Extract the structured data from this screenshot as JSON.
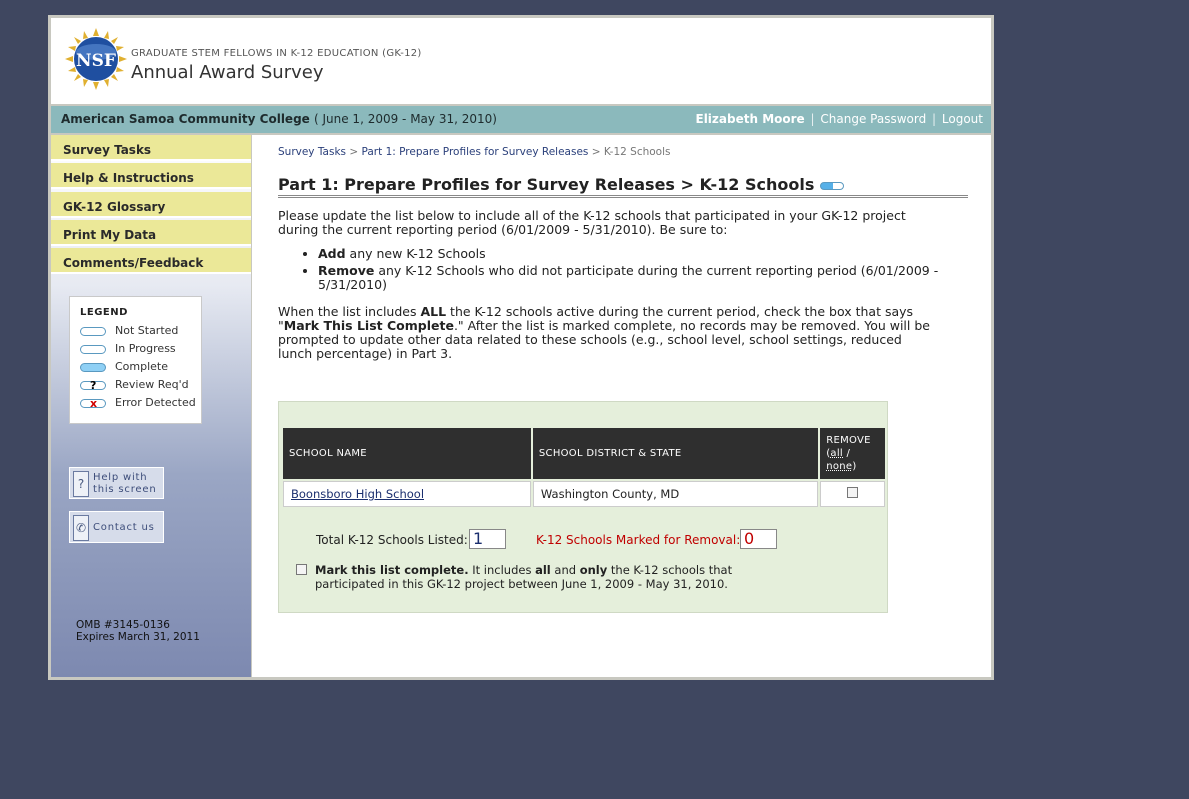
{
  "header": {
    "program": "GRADUATE STEM FELLOWS IN K-12 EDUCATION (GK-12)",
    "title": "Annual Award Survey",
    "logo_text": "NSF"
  },
  "infobar": {
    "institution": "American Samoa Community College",
    "period": "( June 1, 2009 - May 31, 2010)",
    "user": "Elizabeth Moore",
    "change_password": "Change Password",
    "logout": "Logout",
    "separator": "|"
  },
  "sidebar": {
    "nav": [
      "Survey Tasks",
      "Help & Instructions",
      "GK-12 Glossary",
      "Print My Data",
      "Comments/Feedback"
    ],
    "legend": {
      "title": "LEGEND",
      "items": [
        "Not Started",
        "In Progress",
        "Complete",
        "Review Req'd",
        "Error Detected"
      ],
      "review_mark": "?",
      "error_mark": "x"
    },
    "help_line1": "Help with",
    "help_line2": "this screen",
    "help_icon": "?",
    "contact": "Contact us",
    "omb_line1": "OMB #3145-0136",
    "omb_line2": "Expires March 31, 2011"
  },
  "breadcrumb": {
    "c1": "Survey Tasks",
    "c2": "Part 1: Prepare Profiles for Survey Releases",
    "c3": "K-12 Schools",
    "sep": ">"
  },
  "page": {
    "title": "Part 1: Prepare Profiles for Survey Releases > K-12 Schools",
    "intro": "Please update the list below to include all of the K-12 schools that participated in your GK-12 project during the current reporting period (6/01/2009 - 5/31/2010). Be sure to:",
    "bullet1_bold": "Add",
    "bullet1_rest": " any new K-12 Schools",
    "bullet2_bold": "Remove",
    "bullet2_rest": " any K-12 Schools who did not participate during the current reporting period (6/01/2009 - 5/31/2010)",
    "instr_a": "When the list includes ",
    "instr_b": "ALL",
    "instr_c": " the K-12 schools active during the current period, check the box that says \"",
    "instr_d": "Mark This List Complete",
    "instr_e": ".\" After the list is marked complete, no records may be removed. You will be prompted to update other data related to these schools (e.g., school level, school settings, reduced lunch percentage) in Part 3."
  },
  "table": {
    "col_school": "SCHOOL NAME",
    "col_district": "SCHOOL DISTRICT & STATE",
    "col_remove": "REMOVE",
    "remove_all": "all",
    "remove_slash": " / ",
    "remove_none": "none",
    "rows": [
      {
        "school": "Boonsboro High School",
        "district": "Washington County, MD",
        "remove": false
      }
    ]
  },
  "totals": {
    "listed_label": "Total K-12 Schools Listed:",
    "listed_value": "1",
    "removal_label": "K-12 Schools Marked for Removal:",
    "removal_value": "0"
  },
  "complete": {
    "bold_a": "Mark this list complete.",
    "text_b": " It includes ",
    "bold_c": "all",
    "text_d": " and ",
    "bold_e": "only",
    "text_f": " the K-12 schools that participated in this GK-12 project between June 1, 2009 - May 31, 2010."
  },
  "colors": {
    "background": "#3f4760",
    "infobar": "#8bb9bc",
    "nav": "#ebe898",
    "panel": "#e5efdb",
    "table_header": "#2f2f2f",
    "removal": "#c00000"
  }
}
